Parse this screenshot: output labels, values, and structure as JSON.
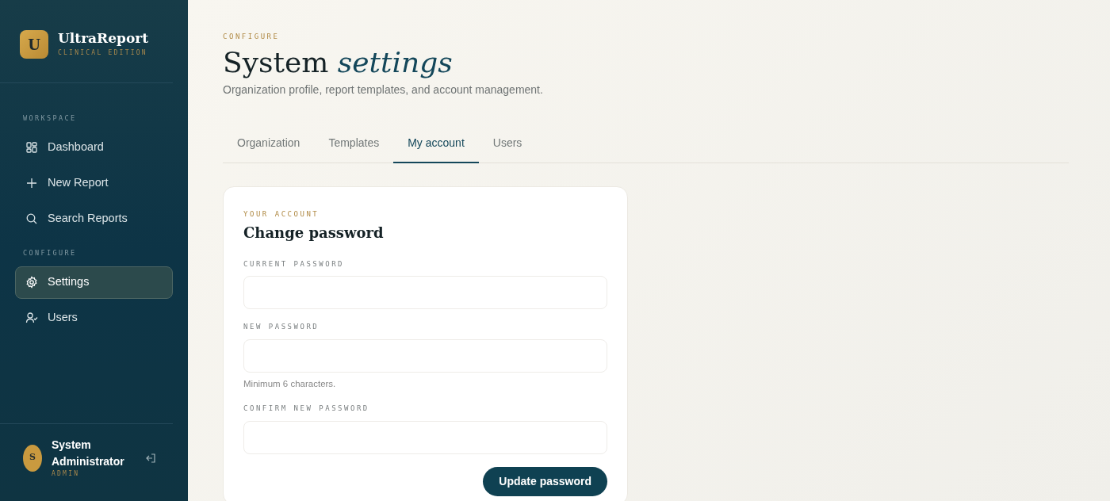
{
  "brand": {
    "logo_letter": "U",
    "name": "UltraReport",
    "edition": "CLINICAL EDITION"
  },
  "sidebar": {
    "sections": [
      {
        "heading": "WORKSPACE",
        "items": [
          {
            "kind": "grid",
            "label": "Dashboard",
            "selected": false
          },
          {
            "kind": "plus",
            "label": "New Report",
            "selected": false
          },
          {
            "kind": "search",
            "label": "Search Reports",
            "selected": false
          }
        ]
      },
      {
        "heading": "CONFIGURE",
        "items": [
          {
            "kind": "gear",
            "label": "Settings",
            "selected": true
          },
          {
            "kind": "user",
            "label": "Users",
            "selected": false
          }
        ]
      }
    ]
  },
  "user": {
    "initial": "S",
    "name": "System Administrator",
    "role": "ADMIN"
  },
  "page": {
    "eyebrow": "CONFIGURE",
    "title": "System",
    "title_accent": "settings",
    "subtitle": "Organization profile, report templates, and account management."
  },
  "tabs": [
    {
      "label": "Organization",
      "selected": false
    },
    {
      "label": "Templates",
      "selected": false
    },
    {
      "label": "My account",
      "selected": true
    },
    {
      "label": "Users",
      "selected": false
    }
  ],
  "card": {
    "eyebrow": "YOUR ACCOUNT",
    "title": "Change password",
    "fields": [
      {
        "label": "CURRENT PASSWORD"
      },
      {
        "label": "NEW PASSWORD",
        "help": "Minimum 6 characters."
      },
      {
        "label": "CONFIRM NEW PASSWORD"
      }
    ],
    "button": "Update password"
  }
}
